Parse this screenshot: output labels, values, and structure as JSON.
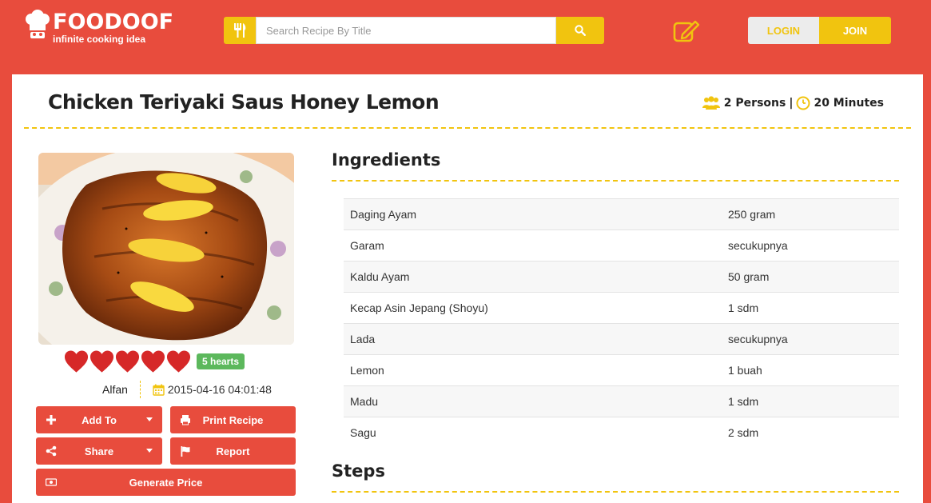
{
  "header": {
    "brand": "FOODOOF",
    "tagline": "infinite cooking idea",
    "search_placeholder": "Search Recipe By Title",
    "login_label": "LOGIN",
    "join_label": "JOIN"
  },
  "recipe": {
    "title": "Chicken Teriyaki Saus Honey Lemon",
    "persons": "2 Persons",
    "separator": "|",
    "duration": "20 Minutes",
    "hearts_count": 5,
    "hearts_label": "5 hearts",
    "author": "Alfan",
    "date": "2015-04-16 04:01:48"
  },
  "actions": {
    "add_to": "Add To",
    "print": "Print Recipe",
    "share": "Share",
    "report": "Report",
    "generate_price": "Generate Price"
  },
  "ingredients_title": "Ingredients",
  "steps_title": "Steps",
  "ingredients": [
    {
      "name": "Daging Ayam",
      "qty": "250 gram"
    },
    {
      "name": "Garam",
      "qty": "secukupnya"
    },
    {
      "name": "Kaldu Ayam",
      "qty": "50 gram"
    },
    {
      "name": "Kecap Asin Jepang (Shoyu)",
      "qty": "1 sdm"
    },
    {
      "name": "Lada",
      "qty": "secukupnya"
    },
    {
      "name": "Lemon",
      "qty": "1 buah"
    },
    {
      "name": "Madu",
      "qty": "1 sdm"
    },
    {
      "name": "Sagu",
      "qty": "2 sdm"
    }
  ],
  "colors": {
    "brand_red": "#e84c3d",
    "accent_yellow": "#f1c40f",
    "heart_red": "#d62828",
    "badge_green": "#5cb85c"
  },
  "icons": [
    "chef-hat-icon",
    "fork-knife-icon",
    "search-icon",
    "edit-icon",
    "users-icon",
    "clock-icon",
    "heart-icon",
    "calendar-icon",
    "plus-icon",
    "print-icon",
    "share-icon",
    "flag-icon",
    "money-icon"
  ]
}
